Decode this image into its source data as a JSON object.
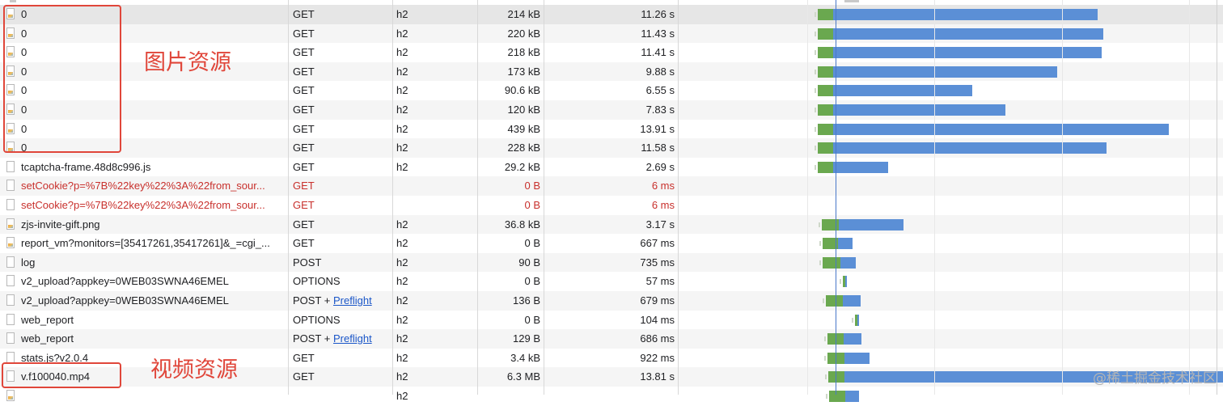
{
  "annotations": {
    "image_resources": "图片资源",
    "video_resources": "视频资源"
  },
  "watermark": "@稀土掘金技术社区",
  "waterfall_colors": {
    "waiting": "#6aa84f",
    "download": "#5b8fd6"
  },
  "requests": [
    {
      "name": "0",
      "method": "GET",
      "protocol": "h2",
      "size": "214 kB",
      "time": "11.26 s",
      "icon": "image-icon",
      "error": false,
      "selected": true,
      "wf_start": 0.255,
      "wf_wait": 0.028,
      "wf_end": 0.77
    },
    {
      "name": "0",
      "method": "GET",
      "protocol": "h2",
      "size": "220 kB",
      "time": "11.43 s",
      "icon": "image-icon",
      "error": false,
      "wf_start": 0.255,
      "wf_wait": 0.028,
      "wf_end": 0.78
    },
    {
      "name": "0",
      "method": "GET",
      "protocol": "h2",
      "size": "218 kB",
      "time": "11.41 s",
      "icon": "image-icon",
      "error": false,
      "wf_start": 0.255,
      "wf_wait": 0.028,
      "wf_end": 0.777
    },
    {
      "name": "0",
      "method": "GET",
      "protocol": "h2",
      "size": "173 kB",
      "time": "9.88 s",
      "icon": "image-icon",
      "error": false,
      "wf_start": 0.255,
      "wf_wait": 0.028,
      "wf_end": 0.695
    },
    {
      "name": "0",
      "method": "GET",
      "protocol": "h2",
      "size": "90.6 kB",
      "time": "6.55 s",
      "icon": "image-icon",
      "error": false,
      "wf_start": 0.255,
      "wf_wait": 0.028,
      "wf_end": 0.539
    },
    {
      "name": "0",
      "method": "GET",
      "protocol": "h2",
      "size": "120 kB",
      "time": "7.83 s",
      "icon": "image-icon",
      "error": false,
      "wf_start": 0.255,
      "wf_wait": 0.028,
      "wf_end": 0.6
    },
    {
      "name": "0",
      "method": "GET",
      "protocol": "h2",
      "size": "439 kB",
      "time": "13.91 s",
      "icon": "image-icon",
      "error": false,
      "wf_start": 0.255,
      "wf_wait": 0.028,
      "wf_end": 0.9
    },
    {
      "name": "0",
      "method": "GET",
      "protocol": "h2",
      "size": "228 kB",
      "time": "11.58 s",
      "icon": "image-icon",
      "error": false,
      "wf_start": 0.255,
      "wf_wait": 0.028,
      "wf_end": 0.785
    },
    {
      "name": "tcaptcha-frame.48d8c996.js",
      "method": "GET",
      "protocol": "h2",
      "size": "29.2 kB",
      "time": "2.69 s",
      "icon": "document-icon",
      "error": false,
      "wf_start": 0.255,
      "wf_wait": 0.028,
      "wf_end": 0.384
    },
    {
      "name": "setCookie?p=%7B%22key%22%3A%22from_sour...",
      "method": "GET",
      "protocol": "",
      "size": "0 B",
      "time": "6 ms",
      "icon": "document-icon",
      "error": true
    },
    {
      "name": "setCookie?p=%7B%22key%22%3A%22from_sour...",
      "method": "GET",
      "protocol": "",
      "size": "0 B",
      "time": "6 ms",
      "icon": "document-icon",
      "error": true
    },
    {
      "name": "zjs-invite-gift.png",
      "method": "GET",
      "protocol": "h2",
      "size": "36.8 kB",
      "time": "3.17 s",
      "icon": "image-icon",
      "error": false,
      "wf_start": 0.262,
      "wf_wait": 0.031,
      "wf_end": 0.412
    },
    {
      "name": "report_vm?monitors=[35417261,35417261]&_=cgi_...",
      "method": "GET",
      "protocol": "h2",
      "size": "0 B",
      "time": "667 ms",
      "icon": "image-icon",
      "error": false,
      "wf_start": 0.263,
      "wf_wait": 0.028,
      "wf_end": 0.318
    },
    {
      "name": "log",
      "method": "POST",
      "protocol": "h2",
      "size": "90 B",
      "time": "735 ms",
      "icon": "document-icon",
      "error": false,
      "wf_start": 0.264,
      "wf_wait": 0.032,
      "wf_end": 0.325
    },
    {
      "name": "v2_upload?appkey=0WEB03SWNA46EMEL",
      "method": "OPTIONS",
      "protocol": "h2",
      "size": "0 B",
      "time": "57 ms",
      "icon": "document-icon",
      "error": false,
      "wf_start": 0.3,
      "wf_wait": 0.005,
      "wf_end": 0.308
    },
    {
      "name": "v2_upload?appkey=0WEB03SWNA46EMEL",
      "method": "POST + ",
      "method_link": "Preflight",
      "protocol": "h2",
      "size": "136 B",
      "time": "679 ms",
      "icon": "document-icon",
      "error": false,
      "wf_start": 0.27,
      "wf_wait": 0.03,
      "wf_end": 0.333
    },
    {
      "name": "web_report",
      "method": "OPTIONS",
      "protocol": "h2",
      "size": "0 B",
      "time": "104 ms",
      "icon": "document-icon",
      "error": false,
      "wf_start": 0.323,
      "wf_wait": 0.005,
      "wf_end": 0.33
    },
    {
      "name": "web_report",
      "method": "POST + ",
      "method_link": "Preflight",
      "protocol": "h2",
      "size": "129 B",
      "time": "686 ms",
      "icon": "document-icon",
      "error": false,
      "wf_start": 0.272,
      "wf_wait": 0.03,
      "wf_end": 0.335
    },
    {
      "name": "stats.js?v2.0.4",
      "method": "GET",
      "protocol": "h2",
      "size": "3.4 kB",
      "time": "922 ms",
      "icon": "document-icon",
      "error": false,
      "wf_start": 0.273,
      "wf_wait": 0.03,
      "wf_end": 0.35
    },
    {
      "name": "v.f100040.mp4",
      "method": "GET",
      "protocol": "h2",
      "size": "6.3 MB",
      "time": "13.81 s",
      "icon": "document-icon",
      "error": false,
      "wf_start": 0.274,
      "wf_wait": 0.03,
      "wf_end": 1.0
    },
    {
      "name": "",
      "method": "",
      "protocol": "h2",
      "size": "",
      "time": "",
      "icon": "image-icon",
      "error": true,
      "wf_start": 0.275,
      "wf_wait": 0.03,
      "wf_end": 0.33
    }
  ]
}
